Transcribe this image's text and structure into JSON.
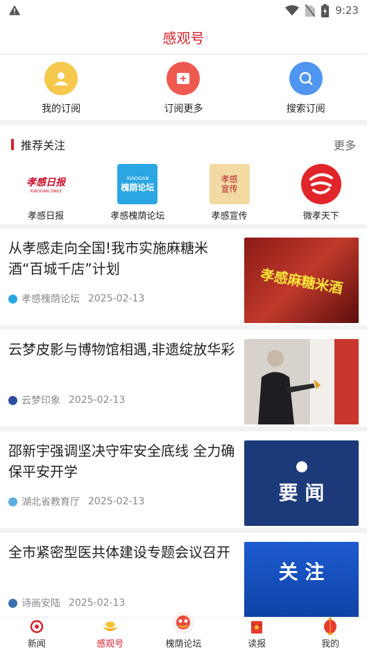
{
  "status": {
    "time": "9:23"
  },
  "header": {
    "title": "感观号"
  },
  "quick": [
    {
      "label": "我的订阅",
      "color": "#f5c94e",
      "icon": "user-icon"
    },
    {
      "label": "订阅更多",
      "color": "#ef5a50",
      "icon": "plus-box-icon"
    },
    {
      "label": "搜索订阅",
      "color": "#4f95ef",
      "icon": "search-icon"
    }
  ],
  "recommend": {
    "title": "推荐关注",
    "more": "更多",
    "items": [
      {
        "label": "孝感日报",
        "logo_text": "孝感日报",
        "logo_sub": "XIAOGAN DAILY"
      },
      {
        "label": "孝感槐荫论坛",
        "logo_text": "槐荫论坛",
        "logo_sub": "XIAOGAN"
      },
      {
        "label": "孝感宣传",
        "logo_text": "孝感宣传"
      },
      {
        "label": "微孝天下",
        "logo_text": ""
      }
    ]
  },
  "news": [
    {
      "title": "从孝感走向全国!我市实施麻糖米酒“百城千店”计划",
      "source": "孝感槐荫论坛",
      "date": "2025-02-13",
      "thumb_text": "孝感麻糖米酒"
    },
    {
      "title": "云梦皮影与博物馆相遇,非遗绽放华彩",
      "source": "云梦印象",
      "date": "2025-02-13",
      "thumb_text": ""
    },
    {
      "title": "邵新宇强调坚决守牢安全底线 全力确保平安开学",
      "source": "湖北省教育厅",
      "date": "2025-02-13",
      "thumb_text": "要 闻"
    },
    {
      "title": "全市紧密型医共体建设专题会议召开",
      "source": "诗画安陆",
      "date": "2025-02-13",
      "thumb_text": "关 注"
    }
  ],
  "tabs": [
    {
      "label": "新闻",
      "active": false
    },
    {
      "label": "感观号",
      "active": true
    },
    {
      "label": "槐荫论坛",
      "active": false
    },
    {
      "label": "读报",
      "active": false
    },
    {
      "label": "我的",
      "active": false
    }
  ]
}
